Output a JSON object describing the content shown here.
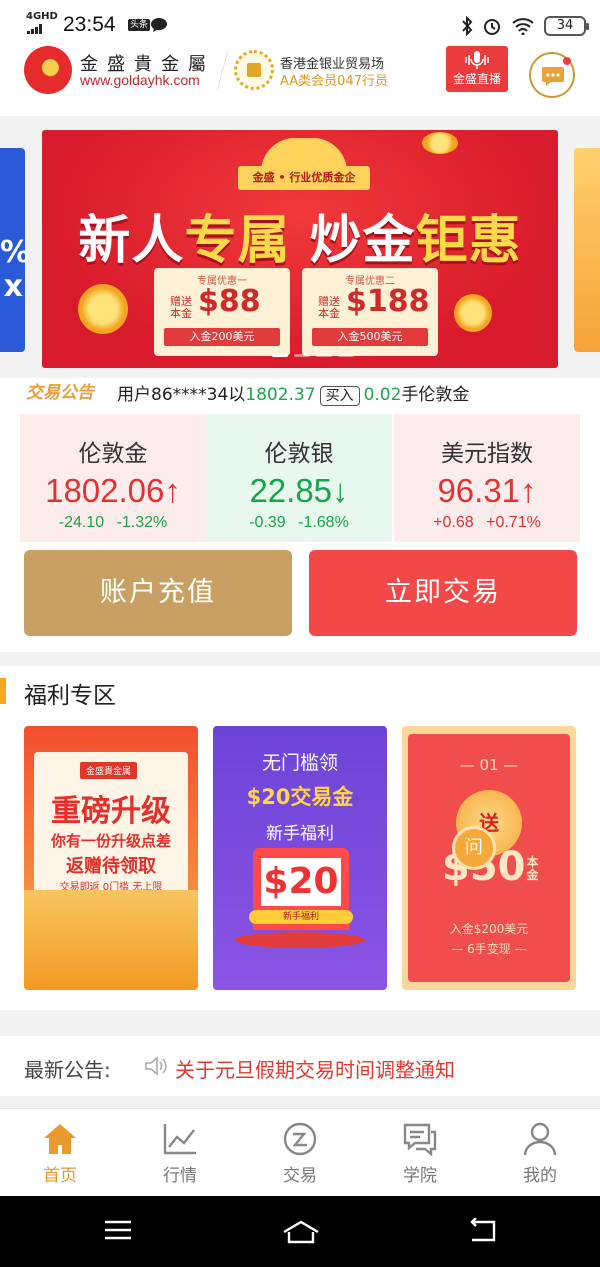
{
  "status_bar": {
    "network": "4GHD",
    "time": "23:54",
    "badge": "头条",
    "battery": "34"
  },
  "header": {
    "brand_name": "金盛貴金屬",
    "brand_url": "www.goldayhk.com",
    "association_line1": "香港金银业贸易场",
    "association_line2": "AA类会员047行员",
    "live_label": "金盛直播"
  },
  "banner": {
    "ribbon": "金盛 • 行业优质金企",
    "title_part1": "新人",
    "title_part2": "专属",
    "title_part3": " 炒金",
    "title_part4": "钜惠",
    "side_left_text": "%\nx",
    "coupons": [
      {
        "head": "专属优惠一",
        "gift": "赠送本金",
        "amount": "$88",
        "foot": "入金200美元"
      },
      {
        "head": "专属优惠二",
        "gift": "赠送本金",
        "amount": "$188",
        "foot": "入金500美元"
      }
    ]
  },
  "ticker": {
    "tag": "交易公告",
    "prefix": "用户86****34以",
    "price": "1802.37",
    "action": "买入",
    "lots": "0.02",
    "suffix": "手伦敦金"
  },
  "quotes": [
    {
      "name": "伦敦金",
      "value": "1802.06↑",
      "change": "-24.10",
      "percent": "-1.32%"
    },
    {
      "name": "伦敦银",
      "value": "22.85↓",
      "change": "-0.39",
      "percent": "-1.68%"
    },
    {
      "name": "美元指数",
      "value": "96.31↑",
      "change": "+0.68",
      "percent": "+0.71%"
    }
  ],
  "actions": {
    "deposit": "账户充值",
    "trade": "立即交易"
  },
  "welfare": {
    "title": "福利专区",
    "card1": {
      "brand": "金盛貴金属",
      "big": "重磅升级",
      "sub1": "你有一份升级点差",
      "sub2": "返赠待领取",
      "sub3": "交易即返  0门槛  无上限"
    },
    "card2": {
      "line1": "无门槛领",
      "line2": "$20交易金",
      "line3": "新手福利",
      "value": "$20",
      "ribbon": "新手福利"
    },
    "card3": {
      "num": "— 01 —",
      "seal": "送",
      "amount": "$50",
      "unit": "本金",
      "info1": "入金$200美元",
      "info2": "— 6手变现 —"
    }
  },
  "help_fab": "问",
  "notice": {
    "label": "最新公告:",
    "text": "关于元旦假期交易时间调整通知"
  },
  "tabs": [
    {
      "label": "首页",
      "icon": "home-icon"
    },
    {
      "label": "行情",
      "icon": "chart-icon"
    },
    {
      "label": "交易",
      "icon": "trade-icon"
    },
    {
      "label": "学院",
      "icon": "academy-icon"
    },
    {
      "label": "我的",
      "icon": "profile-icon"
    }
  ],
  "colors": {
    "accent": "#e89a2c",
    "up": "#e23232",
    "down": "#17a54a",
    "gold_button": "#c9a063",
    "red_button": "#f24848"
  }
}
